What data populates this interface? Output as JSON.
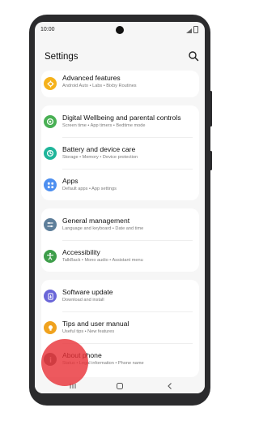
{
  "status_bar": {
    "time": "10:00"
  },
  "header": {
    "title": "Settings",
    "search_icon": "search-icon"
  },
  "items": [
    {
      "title": "Advanced features",
      "subtitle": "Android Auto  •  Labs  •  Bixby Routines",
      "icon": "puzzle-icon",
      "color": "#f5b21b"
    },
    {
      "title": "Digital Wellbeing and parental controls",
      "subtitle": "Screen time  •  App timers  •  Bedtime mode",
      "icon": "wellbeing-icon",
      "color": "#49b054"
    },
    {
      "title": "Battery and device care",
      "subtitle": "Storage  •  Memory  •  Device protection",
      "icon": "battery-care-icon",
      "color": "#1fb59a"
    },
    {
      "title": "Apps",
      "subtitle": "Default apps  •  App settings",
      "icon": "apps-icon",
      "color": "#4d8ff0"
    },
    {
      "title": "General management",
      "subtitle": "Language and keyboard  •  Date and time",
      "icon": "sliders-icon",
      "color": "#5d7e9a"
    },
    {
      "title": "Accessibility",
      "subtitle": "TalkBack  •  Mono audio  •  Assistant menu",
      "icon": "accessibility-icon",
      "color": "#3e9e4a"
    },
    {
      "title": "Software update",
      "subtitle": "Download and install",
      "icon": "software-update-icon",
      "color": "#6a66d8"
    },
    {
      "title": "Tips and user manual",
      "subtitle": "Useful tips  •  New features",
      "icon": "tips-icon",
      "color": "#f0a21e"
    },
    {
      "title": "About phone",
      "subtitle": "Status  •  Legal information  •  Phone name",
      "icon": "info-icon",
      "color": "#6e6e6e"
    }
  ],
  "nav": {
    "recents": "recents-icon",
    "home": "home-icon",
    "back": "back-icon"
  },
  "tap_indicator_color": "#e83036"
}
